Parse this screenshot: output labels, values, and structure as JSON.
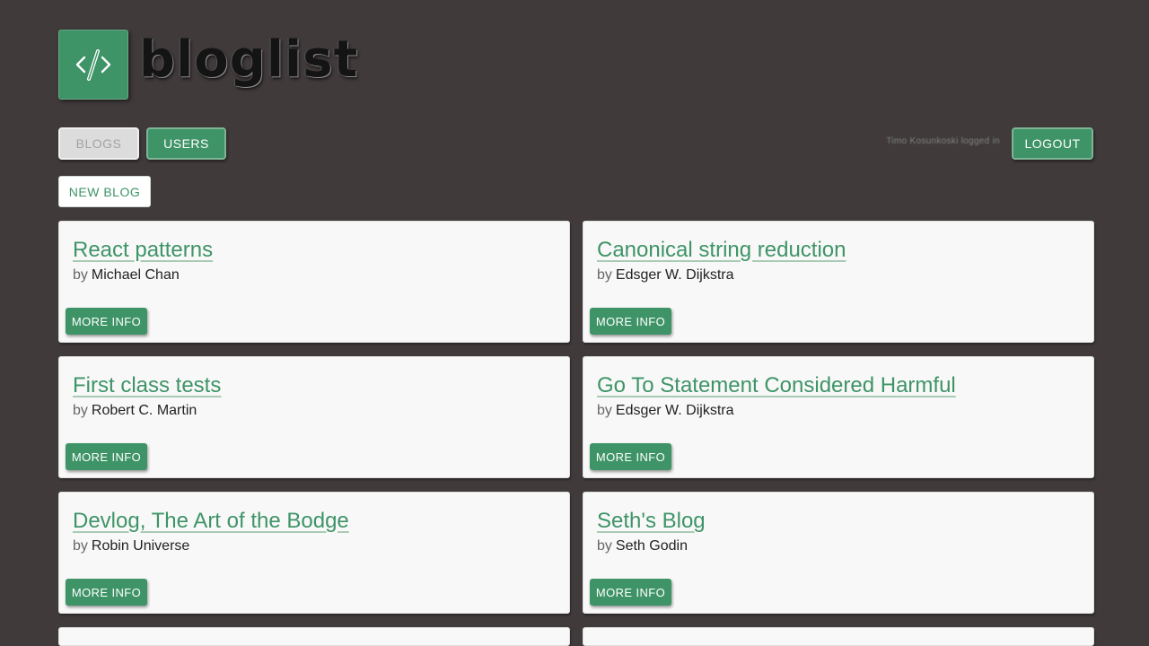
{
  "header": {
    "logo_text": "bloglist",
    "logo_icon": "code-pen-icon"
  },
  "nav": {
    "blogs_label": "BLOGS",
    "users_label": "USERS",
    "user_status": "Timo Kosunkoski logged in",
    "logout_label": "LOGOUT"
  },
  "toolbar": {
    "new_blog_label": "NEW BLOG"
  },
  "blogs": [
    {
      "title": "React patterns",
      "by": "by",
      "author": "Michael Chan",
      "button": "MORE INFO"
    },
    {
      "title": "Canonical string reduction",
      "by": "by",
      "author": "Edsger W. Dijkstra",
      "button": "MORE INFO"
    },
    {
      "title": "First class tests",
      "by": "by",
      "author": "Robert C. Martin",
      "button": "MORE INFO"
    },
    {
      "title": "Go To Statement Considered Harmful",
      "by": "by",
      "author": "Edsger W. Dijkstra",
      "button": "MORE INFO"
    },
    {
      "title": "Devlog, The Art of the Bodge",
      "by": "by",
      "author": "Robin Universe",
      "button": "MORE INFO"
    },
    {
      "title": "Seth's Blog",
      "by": "by",
      "author": "Seth Godin",
      "button": "MORE INFO"
    }
  ],
  "colors": {
    "background": "#403a3b",
    "accent": "#3e9467",
    "card": "#f8f8f8"
  }
}
